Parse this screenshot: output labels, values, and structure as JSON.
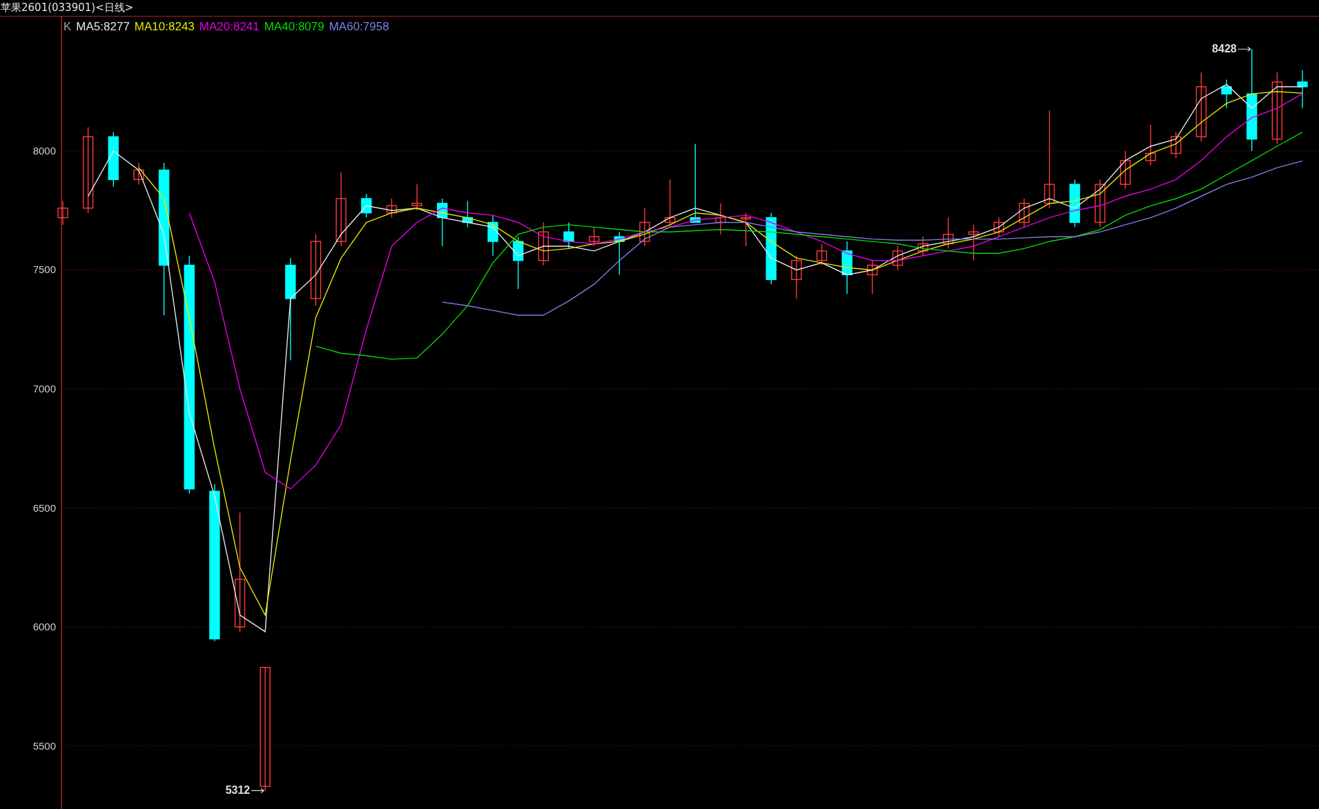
{
  "header": {
    "title": "苹果2601(033901)<日线>"
  },
  "chart": {
    "legend_marker": "K",
    "chart_data": {
      "type": "candlestick",
      "grid": true,
      "ylim": [
        5235,
        8565
      ],
      "yticks": [
        5500,
        6000,
        6500,
        7000,
        7500,
        8000
      ],
      "ohlc": [
        [
          7720,
          7790,
          7690,
          7760
        ],
        [
          7760,
          8100,
          7740,
          8060
        ],
        [
          8060,
          8080,
          7850,
          7880
        ],
        [
          7880,
          7950,
          7860,
          7920
        ],
        [
          7920,
          7950,
          7310,
          7520
        ],
        [
          7520,
          7560,
          6560,
          6580
        ],
        [
          6570,
          6600,
          5940,
          5950
        ],
        [
          6000,
          6480,
          5980,
          6200
        ],
        [
          5330,
          5830,
          5312,
          5830
        ],
        [
          7520,
          7550,
          7120,
          7380
        ],
        [
          7380,
          7650,
          7350,
          7620
        ],
        [
          7620,
          7910,
          7600,
          7800
        ],
        [
          7800,
          7820,
          7720,
          7740
        ],
        [
          7740,
          7800,
          7720,
          7770
        ],
        [
          7770,
          7860,
          7750,
          7780
        ],
        [
          7780,
          7800,
          7600,
          7720
        ],
        [
          7720,
          7790,
          7680,
          7700
        ],
        [
          7700,
          7730,
          7560,
          7620
        ],
        [
          7620,
          7640,
          7420,
          7540
        ],
        [
          7540,
          7700,
          7520,
          7660
        ],
        [
          7660,
          7700,
          7590,
          7620
        ],
        [
          7620,
          7680,
          7600,
          7640
        ],
        [
          7640,
          7660,
          7480,
          7620
        ],
        [
          7620,
          7760,
          7600,
          7700
        ],
        [
          7700,
          7880,
          7680,
          7720
        ],
        [
          7720,
          8030,
          7700,
          7700
        ],
        [
          7700,
          7780,
          7650,
          7720
        ],
        [
          7720,
          7740,
          7600,
          7720
        ],
        [
          7720,
          7740,
          7440,
          7460
        ],
        [
          7460,
          7560,
          7380,
          7540
        ],
        [
          7540,
          7610,
          7520,
          7580
        ],
        [
          7580,
          7620,
          7400,
          7480
        ],
        [
          7480,
          7540,
          7400,
          7520
        ],
        [
          7520,
          7600,
          7500,
          7580
        ],
        [
          7580,
          7640,
          7560,
          7610
        ],
        [
          7610,
          7720,
          7590,
          7650
        ],
        [
          7650,
          7690,
          7540,
          7660
        ],
        [
          7660,
          7720,
          7640,
          7700
        ],
        [
          7700,
          7800,
          7680,
          7780
        ],
        [
          7780,
          8170,
          7760,
          7860
        ],
        [
          7860,
          7880,
          7680,
          7700
        ],
        [
          7700,
          7880,
          7680,
          7860
        ],
        [
          7860,
          8000,
          7840,
          7960
        ],
        [
          7960,
          8110,
          7940,
          7990
        ],
        [
          7990,
          8080,
          7970,
          8060
        ],
        [
          8060,
          8330,
          8040,
          8270
        ],
        [
          8270,
          8300,
          8180,
          8240
        ],
        [
          8240,
          8428,
          8000,
          8050
        ],
        [
          8050,
          8330,
          8030,
          8290
        ],
        [
          8290,
          8340,
          8180,
          8270
        ]
      ],
      "series": [
        {
          "name": "MA5:8277",
          "type": "line",
          "color": "#e6e6e6",
          "values": [
            null,
            7810,
            8000,
            7920,
            7650,
            6900,
            6550,
            6050,
            5980,
            7380,
            7480,
            7650,
            7770,
            7750,
            7760,
            7720,
            7700,
            7680,
            7560,
            7600,
            7600,
            7580,
            7620,
            7660,
            7720,
            7760,
            7730,
            7700,
            7550,
            7500,
            7530,
            7480,
            7500,
            7560,
            7600,
            7620,
            7640,
            7680,
            7760,
            7800,
            7760,
            7840,
            7960,
            8020,
            8050,
            8220,
            8280,
            8180,
            8270,
            8270
          ]
        },
        {
          "name": "MA10:8243",
          "type": "line",
          "color": "#e6e600",
          "values": [
            null,
            null,
            null,
            7930,
            7800,
            7300,
            6750,
            6250,
            6050,
            6700,
            7300,
            7550,
            7700,
            7740,
            7760,
            7740,
            7720,
            7690,
            7620,
            7580,
            7590,
            7610,
            7620,
            7650,
            7690,
            7740,
            7730,
            7700,
            7620,
            7550,
            7530,
            7510,
            7500,
            7540,
            7580,
            7610,
            7630,
            7660,
            7720,
            7780,
            7790,
            7820,
            7920,
            7990,
            8030,
            8120,
            8200,
            8240,
            8250,
            8243
          ]
        },
        {
          "name": "MA20:8241",
          "type": "line",
          "color": "#e600e6",
          "values": [
            null,
            null,
            null,
            null,
            null,
            7740,
            7450,
            7000,
            6650,
            6580,
            6680,
            6850,
            7250,
            7600,
            7700,
            7760,
            7740,
            7730,
            7700,
            7640,
            7620,
            7610,
            7630,
            7660,
            7680,
            7710,
            7720,
            7730,
            7700,
            7660,
            7620,
            7570,
            7540,
            7540,
            7560,
            7580,
            7600,
            7640,
            7680,
            7720,
            7750,
            7770,
            7810,
            7840,
            7880,
            7960,
            8060,
            8140,
            8180,
            8241
          ]
        },
        {
          "name": "MA40:8079",
          "type": "line",
          "color": "#00dd00",
          "values": [
            null,
            null,
            null,
            null,
            null,
            null,
            null,
            null,
            null,
            null,
            7180,
            7150,
            7140,
            7125,
            7130,
            7230,
            7350,
            7530,
            7650,
            7680,
            7690,
            7680,
            7670,
            7660,
            7660,
            7665,
            7670,
            7665,
            7660,
            7650,
            7640,
            7630,
            7620,
            7610,
            7590,
            7580,
            7570,
            7570,
            7590,
            7620,
            7640,
            7670,
            7730,
            7770,
            7800,
            7840,
            7900,
            7960,
            8020,
            8079
          ]
        },
        {
          "name": "MA60:7958",
          "type": "line",
          "color": "#7f7fe6",
          "values": [
            null,
            null,
            null,
            null,
            null,
            null,
            null,
            null,
            null,
            null,
            null,
            null,
            null,
            null,
            null,
            7365,
            7350,
            7330,
            7310,
            7310,
            7370,
            7440,
            7540,
            7630,
            7680,
            7690,
            7700,
            7700,
            7680,
            7660,
            7650,
            7640,
            7630,
            7625,
            7625,
            7630,
            7630,
            7630,
            7635,
            7640,
            7640,
            7660,
            7690,
            7720,
            7760,
            7810,
            7860,
            7890,
            7930,
            7958
          ]
        }
      ],
      "annotations": [
        "8428",
        "5312"
      ]
    }
  }
}
